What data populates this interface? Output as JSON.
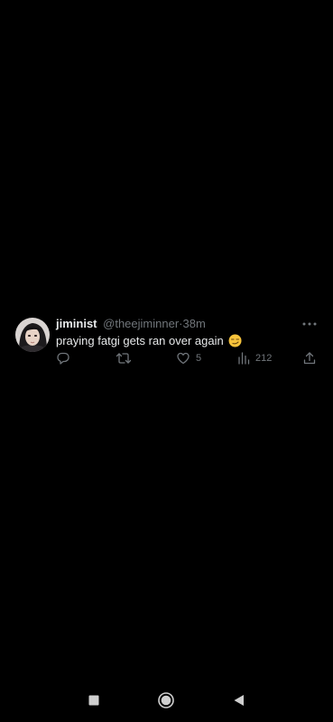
{
  "tweet": {
    "display_name": "jiminist",
    "handle": "@theejiminner",
    "separator": "·",
    "time": "38m",
    "text": "praying fatgi gets ran over again",
    "emoji": "smirking-face",
    "likes": "5",
    "views": "212"
  },
  "icons": {
    "reply": "reply-icon",
    "retweet": "retweet-icon",
    "like": "heart-icon",
    "views": "views-bar-chart-icon",
    "share": "share-icon",
    "more": "more-dots-icon"
  },
  "nav": {
    "recent": "square-icon",
    "home": "circle-home-icon",
    "back": "triangle-back-icon"
  },
  "colors": {
    "background": "#000000",
    "primary_text": "#e7e9ea",
    "secondary_text": "#71767b",
    "nav_icon": "#cfcfcf"
  }
}
